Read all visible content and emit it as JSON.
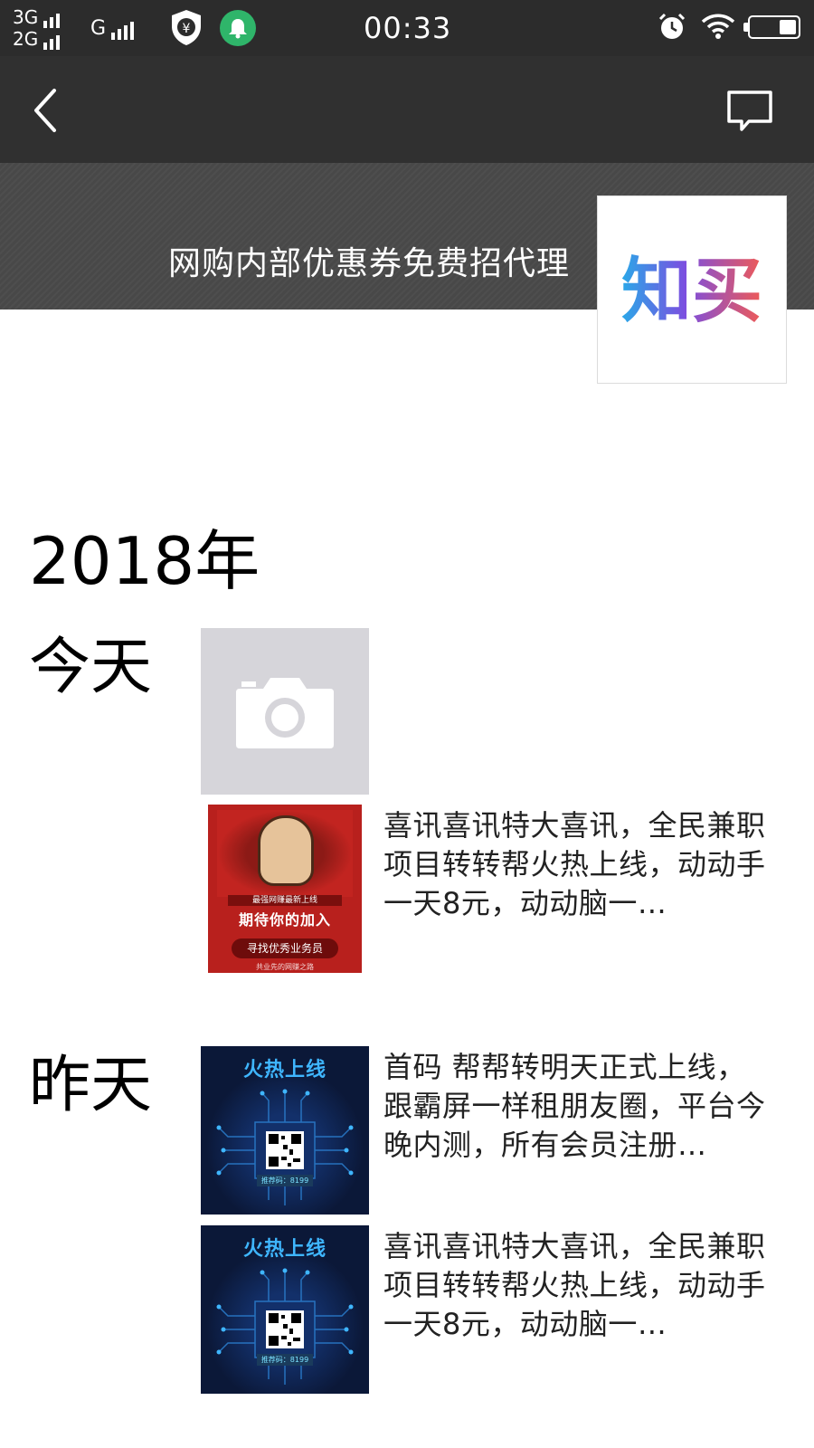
{
  "status_bar": {
    "net_top": "3G",
    "net_bottom": "2G",
    "net_g": "G",
    "time": "00:33",
    "icons": [
      "signal-icon",
      "shield-yen-icon",
      "bell-icon",
      "alarm-icon",
      "wifi-icon",
      "battery-icon"
    ]
  },
  "nav": {
    "back_icon": "chevron-left-icon",
    "message_icon": "comment-icon"
  },
  "profile": {
    "name": "网购内部优惠券免费招代理",
    "avatar_text": "知买",
    "colors": {
      "nav_bg": "#303030",
      "cover_bg": "#4a4a4a"
    }
  },
  "timeline": {
    "year": "2018年",
    "today_label": "今天",
    "yesterday_label": "昨天",
    "camera_icon": "camera-icon",
    "posts": [
      {
        "text": "喜讯喜讯特大喜讯，全民兼职项目转转帮火热上线，动动手一天8元，动动脑一…",
        "poster_tag": "最强网赚最新上线",
        "poster_big": "期待你的加入",
        "poster_pill": "寻找优秀业务员",
        "poster_small": "共业先的网赚之路"
      },
      {
        "text": "首码 帮帮转明天正式上线，跟霸屏一样租朋友圈，平台今晚内测，所有会员注册…",
        "poster_headline": "火热上线",
        "poster_code": "推荐码：8199"
      },
      {
        "text": "喜讯喜讯特大喜讯，全民兼职项目转转帮火热上线，动动手一天8元，动动脑一…",
        "poster_headline": "火热上线",
        "poster_code": "推荐码：8199"
      }
    ]
  }
}
